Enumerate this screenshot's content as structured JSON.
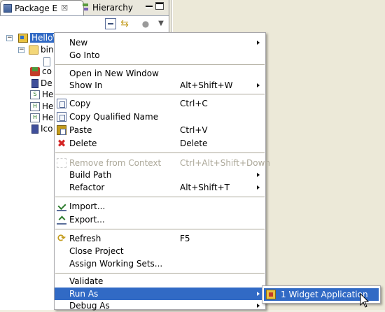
{
  "tabs": {
    "package_explorer": "Package E",
    "hierarchy": "Hierarchy",
    "close_glyph": "☒"
  },
  "tree": {
    "items": [
      {
        "label": "HelloW",
        "icon": "project-icon"
      },
      {
        "label": "bin",
        "icon": "folder-icon"
      },
      {
        "label": "",
        "icon": "file-icon"
      },
      {
        "label": "co",
        "icon": "cube-icon"
      },
      {
        "label": "De",
        "icon": "library-icon"
      },
      {
        "label": "He",
        "icon": "h-file-icon"
      },
      {
        "label": "He",
        "icon": "h-file-icon"
      },
      {
        "label": "He",
        "icon": "h-file-icon"
      },
      {
        "label": "Ico",
        "icon": "library-icon"
      }
    ]
  },
  "context_menu": {
    "items": [
      {
        "label": "New",
        "accel": "",
        "submenu": true
      },
      {
        "label": "Go Into",
        "accel": ""
      },
      {
        "label": "Open in New Window",
        "accel": ""
      },
      {
        "label": "Show In",
        "accel": "Alt+Shift+W",
        "submenu": true
      },
      {
        "label": "Copy",
        "accel": "Ctrl+C",
        "icon": "copy-icon"
      },
      {
        "label": "Copy Qualified Name",
        "accel": "",
        "icon": "copy-qualified-icon"
      },
      {
        "label": "Paste",
        "accel": "Ctrl+V",
        "icon": "paste-icon"
      },
      {
        "label": "Delete",
        "accel": "Delete",
        "icon": "delete-icon"
      },
      {
        "label": "Remove from Context",
        "accel": "Ctrl+Alt+Shift+Down",
        "disabled": true
      },
      {
        "label": "Build Path",
        "accel": "",
        "submenu": true
      },
      {
        "label": "Refactor",
        "accel": "Alt+Shift+T",
        "submenu": true
      },
      {
        "label": "Import...",
        "accel": "",
        "icon": "import-icon"
      },
      {
        "label": "Export...",
        "accel": "",
        "icon": "export-icon"
      },
      {
        "label": "Refresh",
        "accel": "F5",
        "icon": "refresh-icon"
      },
      {
        "label": "Close Project",
        "accel": ""
      },
      {
        "label": "Assign Working Sets...",
        "accel": ""
      },
      {
        "label": "Validate",
        "accel": ""
      },
      {
        "label": "Run As",
        "accel": "",
        "submenu": true,
        "highlighted": true
      },
      {
        "label": "Debug As",
        "accel": "",
        "submenu": true
      }
    ]
  },
  "run_as_submenu": {
    "items": [
      {
        "label": "1 Widget Application",
        "icon": "run-app-icon",
        "highlighted": true
      }
    ]
  },
  "colors": {
    "selection": "#316ac5",
    "menu_bg": "#ffffff",
    "separator": "#aca899",
    "disabled_text": "#aca899"
  }
}
